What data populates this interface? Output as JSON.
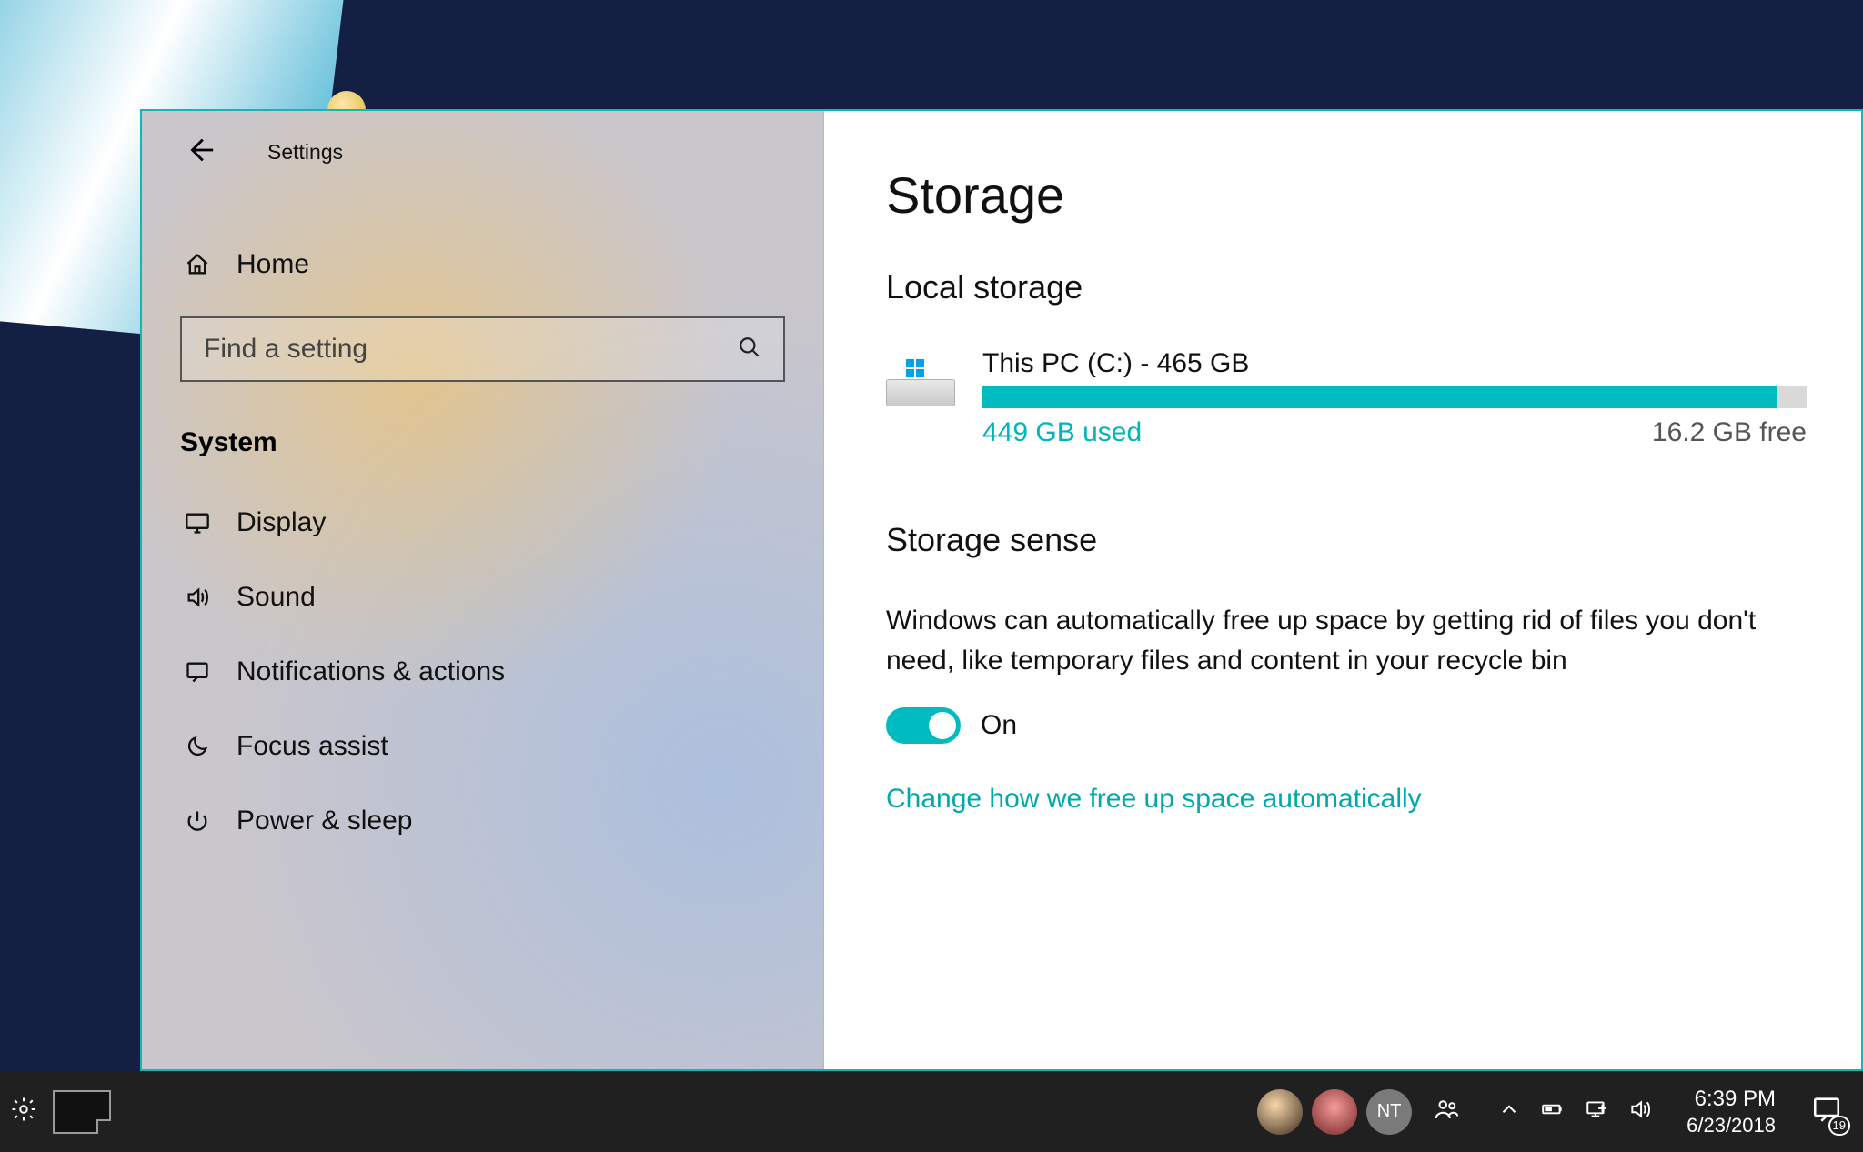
{
  "window": {
    "title": "Settings"
  },
  "sidebar": {
    "home_label": "Home",
    "search_placeholder": "Find a setting",
    "category": "System",
    "items": [
      {
        "label": "Display"
      },
      {
        "label": "Sound"
      },
      {
        "label": "Notifications & actions"
      },
      {
        "label": "Focus assist"
      },
      {
        "label": "Power & sleep"
      }
    ]
  },
  "main": {
    "title": "Storage",
    "local_section": "Local storage",
    "drive": {
      "name": "This PC (C:) - 465 GB",
      "used_label": "449 GB used",
      "free_label": "16.2 GB free",
      "fill_percent": 96.5
    },
    "sense": {
      "title": "Storage sense",
      "desc": "Windows can automatically free up space by getting rid of files you don't need, like temporary files and content in your recycle bin",
      "toggle_label": "On",
      "change_link": "Change how we free up space automatically"
    }
  },
  "taskbar": {
    "avatar_initials": "NT",
    "time": "6:39 PM",
    "date": "6/23/2018",
    "notification_count": "19"
  },
  "colors": {
    "accent": "#00bcc1",
    "accent_text": "#00a8ad"
  }
}
